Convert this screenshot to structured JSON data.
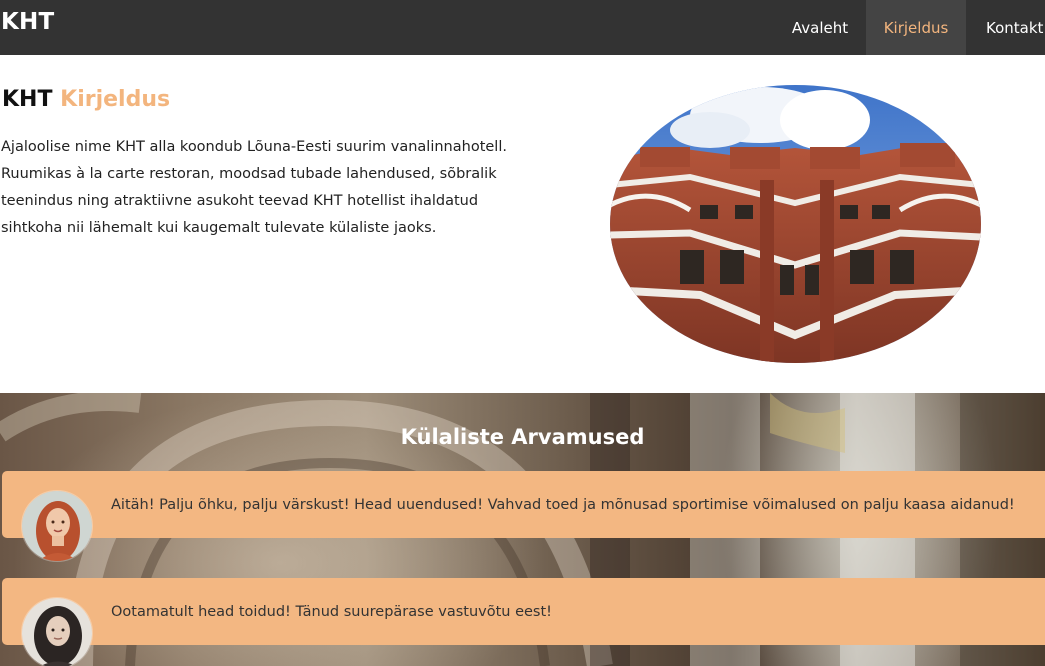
{
  "nav": {
    "brand": "KHT",
    "links": [
      {
        "label": "Avaleht",
        "active": false
      },
      {
        "label": "Kirjeldus",
        "active": true
      },
      {
        "label": "Kontakt",
        "active": false
      }
    ]
  },
  "about": {
    "title_main": "KHT",
    "title_accent": "Kirjeldus",
    "text": "Ajaloolise nime KHT alla koondub Lõuna-Eesti suurim vanalinnahotell. Ruumikas à la carte restoran, moodsad tubade lahendused, sõbralik teenindus ning atraktiivne asukoht teevad KHT hotellist ihaldatud sihtkoha nii lähemalt kui kaugemalt tulevate külaliste jaoks.",
    "image_icon": "hotel-building-photo"
  },
  "reviews": {
    "title": "Külaliste Arvamused",
    "items": [
      {
        "text": "Aitäh! Palju õhku, palju värskust! Head uuendused! Vahvad toed ja mõnusad sportimise võimalused on palju kaasa aidanud!",
        "avatar": "woman-red-hair-avatar"
      },
      {
        "text": "Ootamatult head toidud! Tänud suurepärase vastuvõtu eest!",
        "avatar": "woman-curly-hair-avatar"
      }
    ]
  },
  "colors": {
    "navbar": "#333333",
    "accent": "#f3b57e",
    "card": "#f3b782"
  }
}
